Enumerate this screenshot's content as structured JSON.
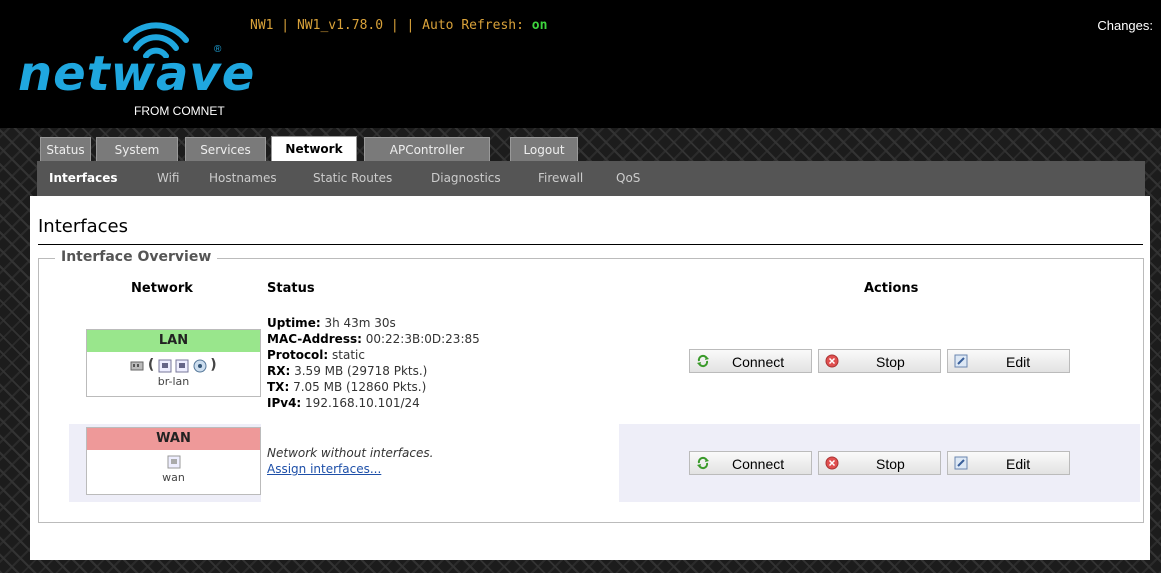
{
  "header": {
    "logo_text": "netwave",
    "logo_sub": "FROM COMNET",
    "logo_reg": "®",
    "status_prefix": "NW1 | NW1_v1.78.0 | | Auto Refresh: ",
    "auto_refresh": "on",
    "changes_label": "Changes: "
  },
  "tabs": [
    {
      "label": "Status"
    },
    {
      "label": "System"
    },
    {
      "label": "Services"
    },
    {
      "label": "Network"
    },
    {
      "label": "APController"
    },
    {
      "label": "Logout"
    }
  ],
  "subtabs": [
    {
      "label": "Interfaces"
    },
    {
      "label": "Wifi"
    },
    {
      "label": "Hostnames"
    },
    {
      "label": "Static Routes"
    },
    {
      "label": "Diagnostics"
    },
    {
      "label": "Firewall"
    },
    {
      "label": "QoS"
    }
  ],
  "page": {
    "title": "Interfaces",
    "section": "Interface Overview",
    "columns": {
      "network": "Network",
      "status": "Status",
      "actions": "Actions"
    }
  },
  "interfaces": [
    {
      "name": "LAN",
      "color": "#99e68c",
      "device": "br-lan",
      "devline_open": "(",
      "devline_close": ")",
      "uptime_label": "Uptime:",
      "uptime": " 3h 43m 30s",
      "mac_label": "MAC-Address:",
      "mac": " 00:22:3B:0D:23:85",
      "proto_label": "Protocol:",
      "proto": " static",
      "rx_label": "RX:",
      "rx": " 3.59 MB (29718 Pkts.)",
      "tx_label": "TX:",
      "tx": " 7.05 MB (12860 Pkts.)",
      "ipv4_label": "IPv4:",
      "ipv4": " 192.168.10.101/24"
    },
    {
      "name": "WAN",
      "color": "#ee9999",
      "device": "wan",
      "status_text": "Network without interfaces.",
      "assign_link": "Assign interfaces..."
    }
  ],
  "actions": {
    "connect": "Connect",
    "stop": "Stop",
    "edit": "Edit"
  },
  "colors": {
    "accent": "#1fa7df",
    "refresh_on": "#3ed63e",
    "version_text": "#d9a23a"
  }
}
